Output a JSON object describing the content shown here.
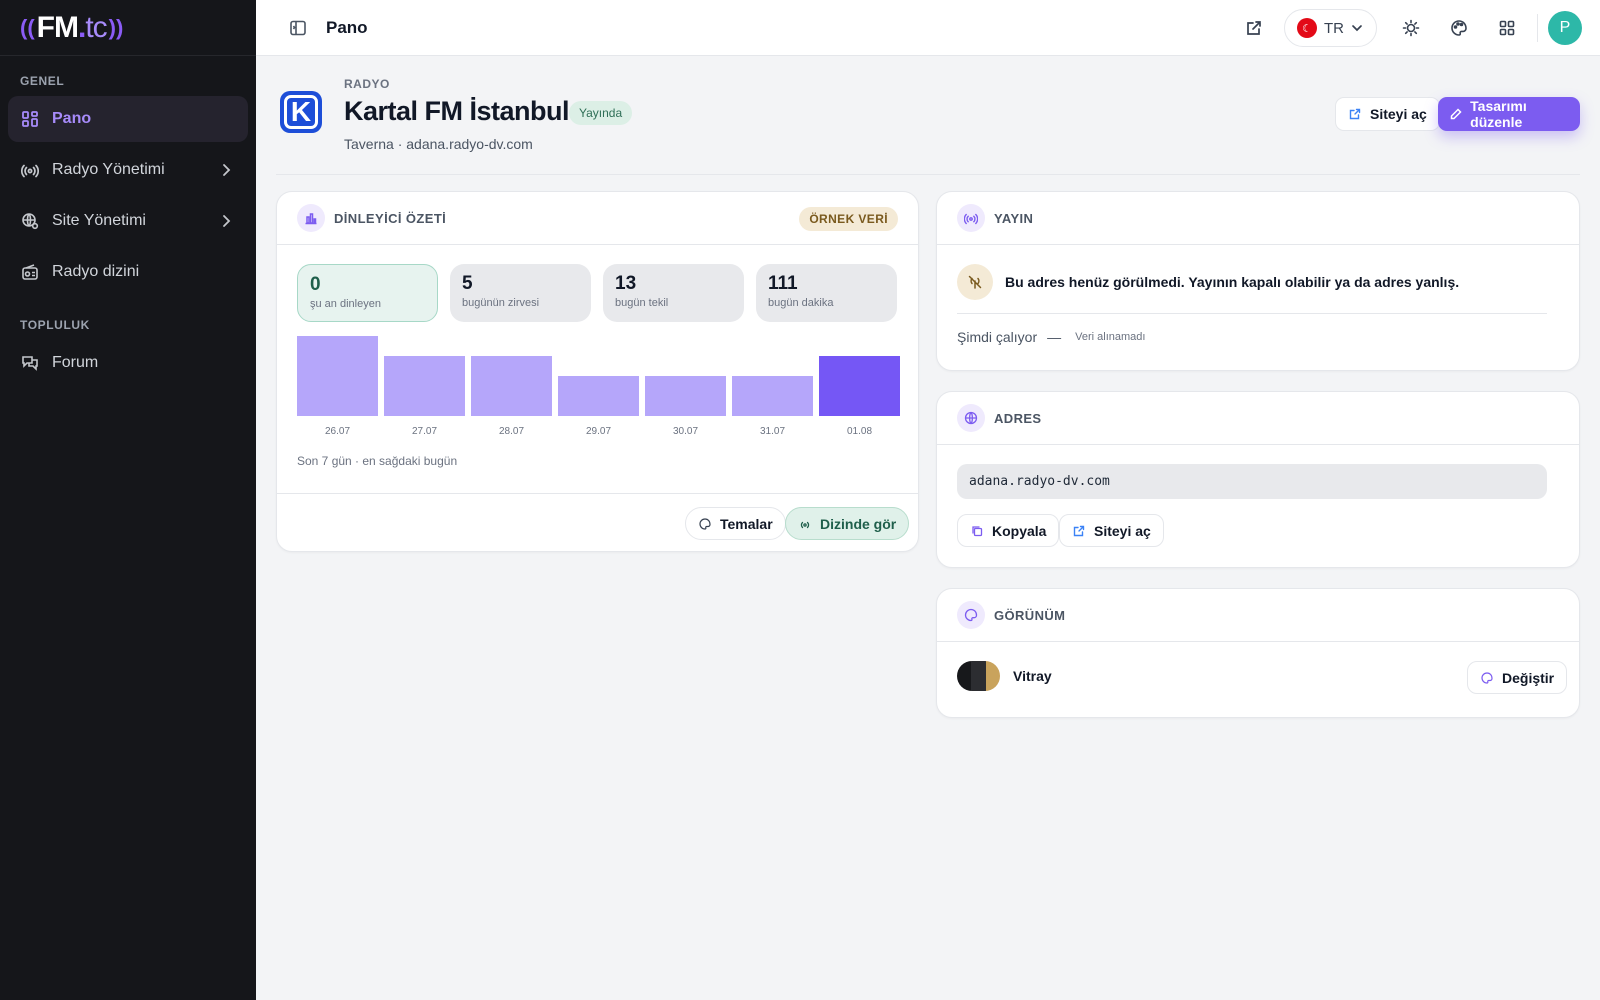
{
  "brand": {
    "name_main": "FM",
    "name_dot": ".",
    "name_tld": "tc"
  },
  "sidebar": {
    "sections": [
      {
        "title": "GENEL",
        "items": [
          {
            "label": "Pano",
            "icon": "dashboard-icon",
            "active": true
          },
          {
            "label": "Radyo Yönetimi",
            "icon": "radio-waves-icon",
            "has_submenu": true
          },
          {
            "label": "Site Yönetimi",
            "icon": "globe-settings-icon",
            "has_submenu": true
          },
          {
            "label": "Radyo dizini",
            "icon": "radio-icon"
          }
        ]
      },
      {
        "title": "TOPLULUK",
        "items": [
          {
            "label": "Forum",
            "icon": "forum-icon"
          }
        ]
      }
    ]
  },
  "topbar": {
    "title": "Pano",
    "language": "TR",
    "avatar_initial": "P"
  },
  "header": {
    "breadcrumb": "RADYO",
    "station_name": "Kartal FM İstanbul",
    "status": "Yayında",
    "subtitle": "Taverna · adana.radyo-dv.com",
    "open_site_label": "Siteyi aç",
    "edit_design_label": "Tasarımı düzenle"
  },
  "listener_card": {
    "title": "DİNLEYİCİ ÖZETİ",
    "badge": "ÖRNEK VERİ",
    "stats": [
      {
        "value": "0",
        "label": "şu an dinleyen"
      },
      {
        "value": "5",
        "label": "bugünün zirvesi"
      },
      {
        "value": "13",
        "label": "bugün tekil"
      },
      {
        "value": "111",
        "label": "bugün dakika"
      }
    ],
    "note": "Son 7 gün · en sağdaki bugün",
    "themes_label": "Temalar",
    "directory_label": "Dizinde gör"
  },
  "chart_data": {
    "type": "bar",
    "categories": [
      "26.07",
      "27.07",
      "28.07",
      "29.07",
      "30.07",
      "31.07",
      "01.08"
    ],
    "values": [
      4,
      3,
      3,
      2,
      2,
      2,
      3
    ],
    "ylim": [
      0,
      4
    ],
    "grid": false,
    "colors": {
      "bar": "#b5a6fa",
      "today": "#7557f5"
    }
  },
  "broadcast_card": {
    "title": "YAYIN",
    "notice": "Bu adres henüz görülmedi. Yayının kapalı olabilir ya da adres yanlış.",
    "now_playing_label": "Şimdi çalıyor",
    "now_playing_sep": "—",
    "now_playing_value": "Veri alınamadı"
  },
  "address_card": {
    "title": "ADRES",
    "address": "adana.radyo-dv.com",
    "copy_label": "Kopyala",
    "open_site_label": "Siteyi aç"
  },
  "appearance_card": {
    "title": "GÖRÜNÜM",
    "theme_name": "Vitray",
    "change_label": "Değiştir",
    "swatch_colors": [
      "#17181b",
      "#2c2d31",
      "#c9a35c"
    ]
  },
  "colors": {
    "accent": "#7c5cf0",
    "sidebar_bg": "#15161a",
    "success": "#2f6f57"
  }
}
